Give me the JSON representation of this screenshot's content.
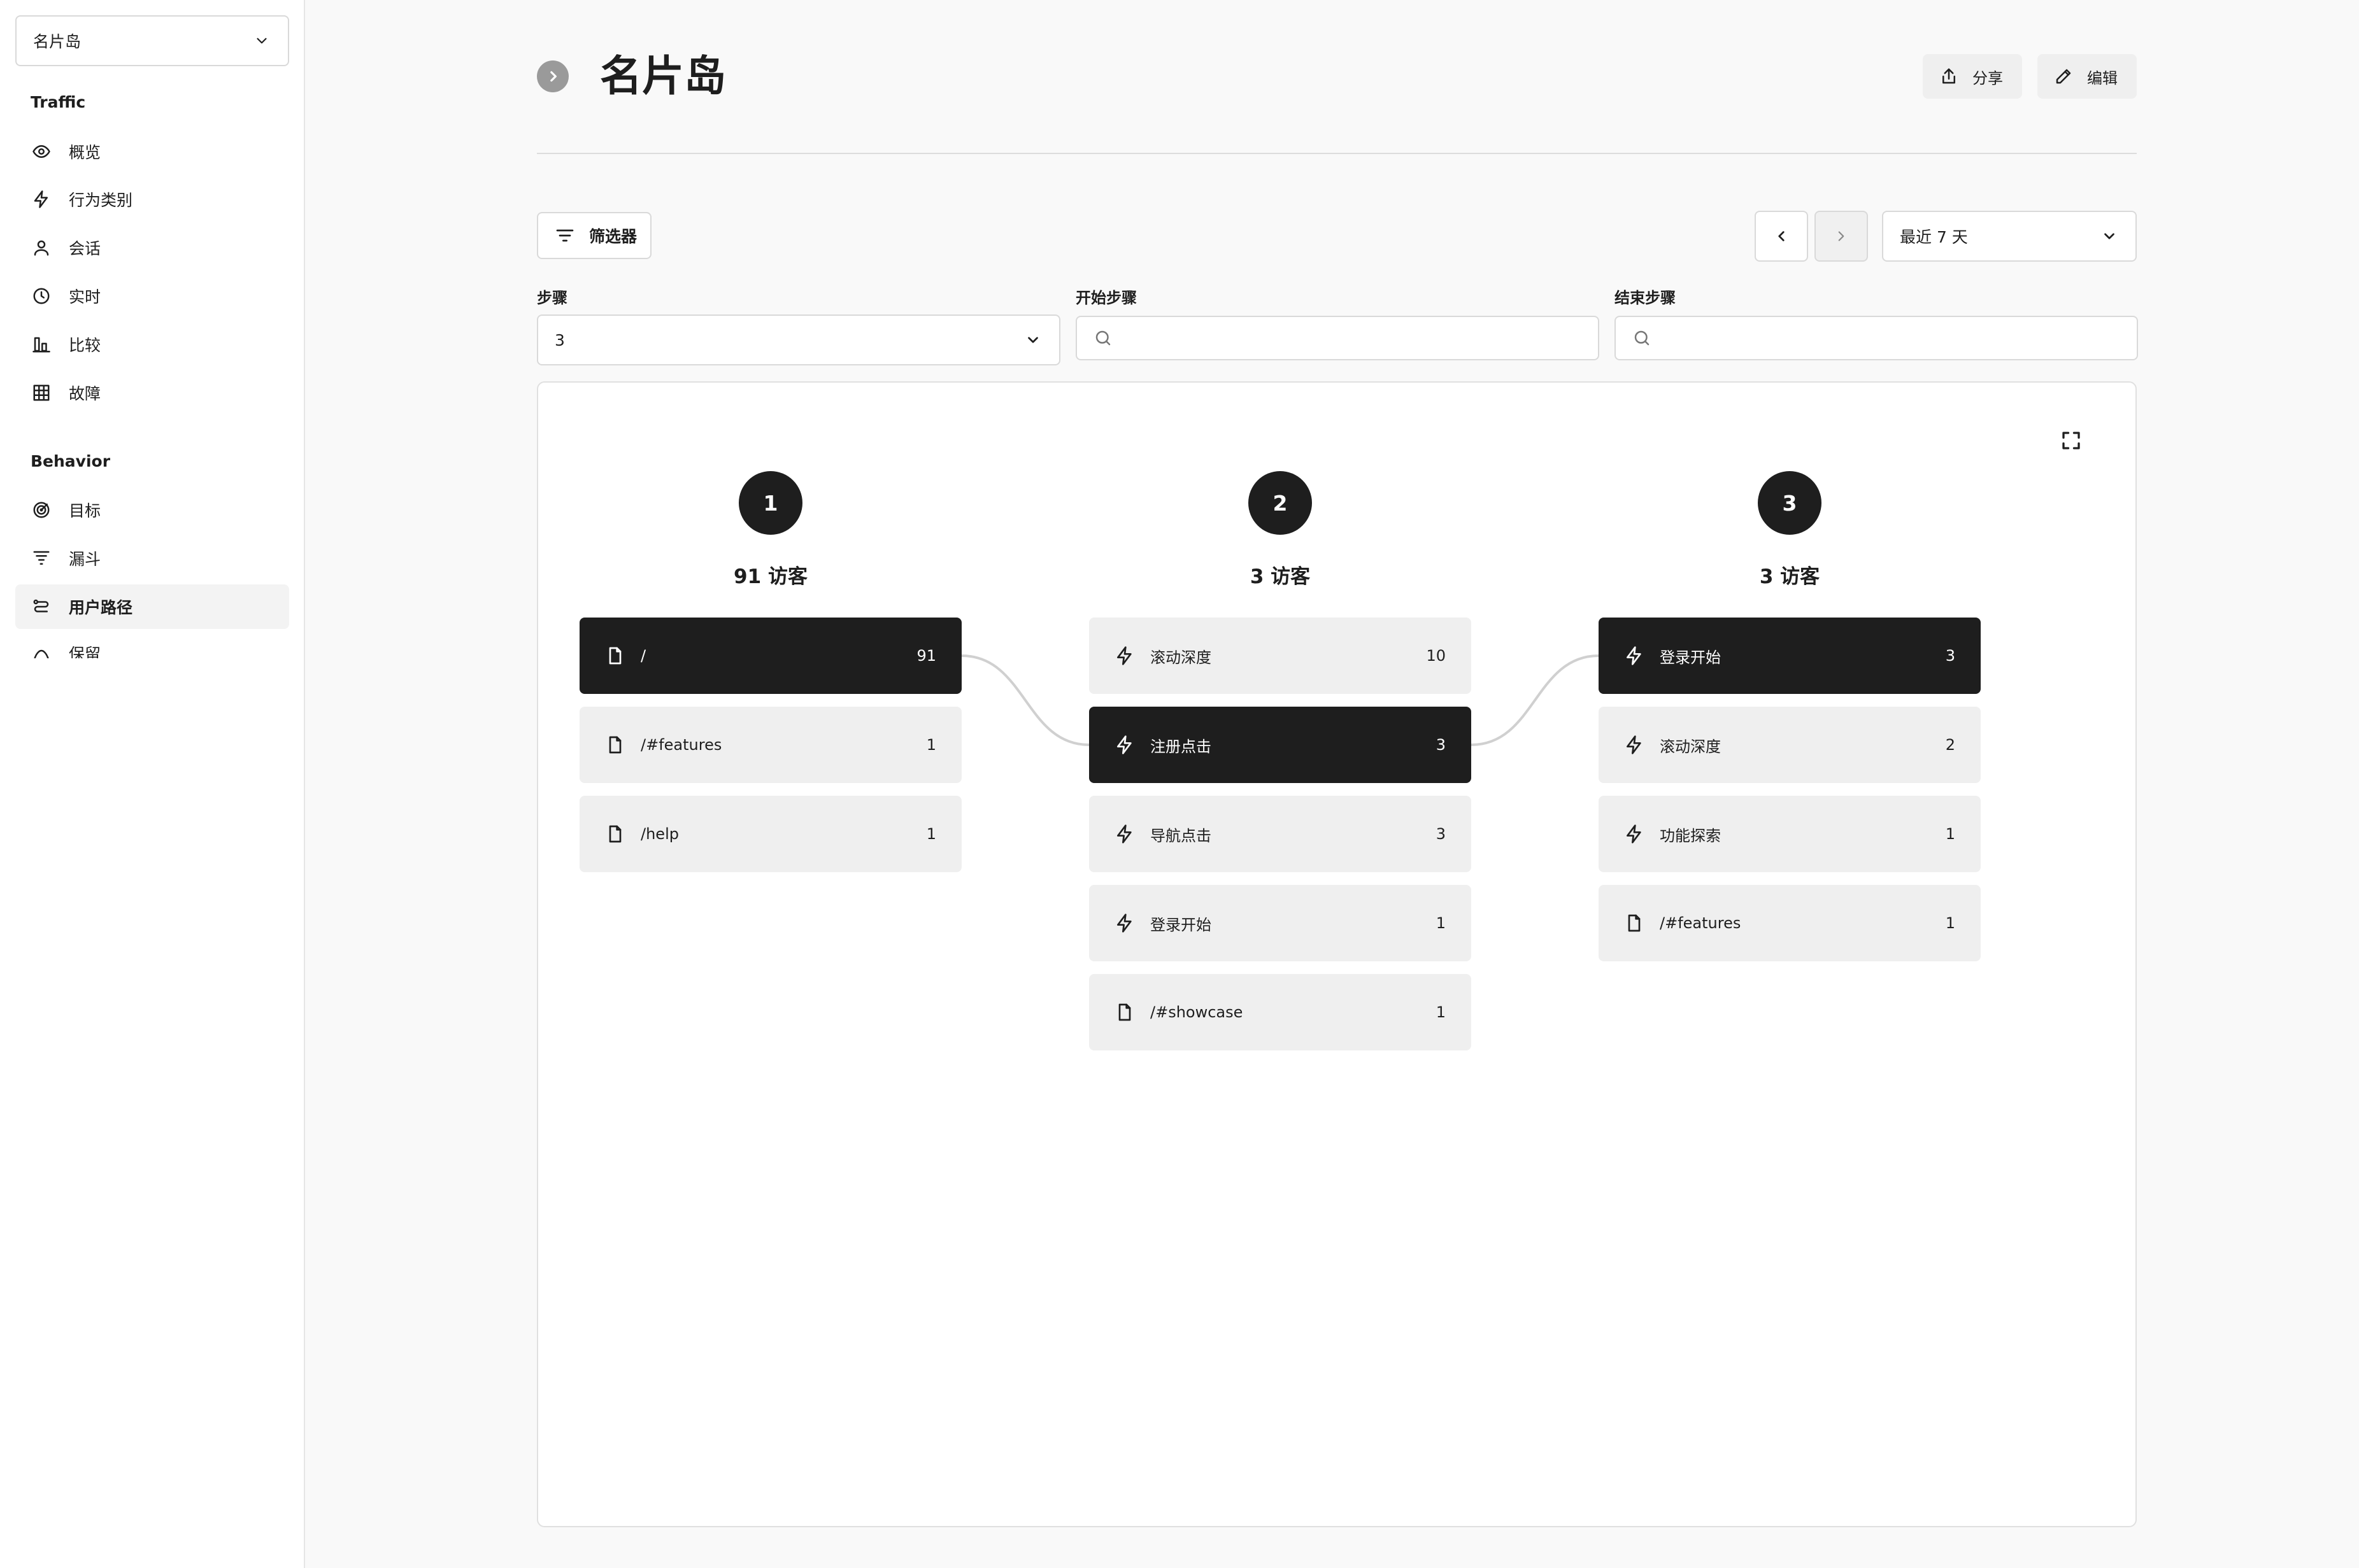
{
  "site_selector": {
    "value": "名片岛"
  },
  "sidebar": {
    "traffic_title": "Traffic",
    "traffic_items": [
      {
        "label": "概览",
        "icon": "eye-icon"
      },
      {
        "label": "行为类别",
        "icon": "lightning-icon"
      },
      {
        "label": "会话",
        "icon": "user-icon"
      },
      {
        "label": "实时",
        "icon": "clock-icon"
      },
      {
        "label": "比较",
        "icon": "compare-icon"
      },
      {
        "label": "故障",
        "icon": "table-icon"
      }
    ],
    "behavior_title": "Behavior",
    "behavior_items": [
      {
        "label": "目标",
        "icon": "target-icon"
      },
      {
        "label": "漏斗",
        "icon": "funnel-icon"
      },
      {
        "label": "用户路径",
        "icon": "path-icon",
        "active": true
      },
      {
        "label": "保留",
        "icon": "retention-icon"
      }
    ]
  },
  "header": {
    "title": "名片岛",
    "share_label": "分享",
    "edit_label": "编辑"
  },
  "filters": {
    "filter_label": "筛选器",
    "date_range": "最近 7 天"
  },
  "controls": {
    "steps_label": "步骤",
    "steps_value": "3",
    "start_step_label": "开始步骤",
    "end_step_label": "结束步骤"
  },
  "journey": {
    "steps": [
      {
        "number": "1",
        "visitors": "91 访客",
        "nodes": [
          {
            "type": "page",
            "icon": "file-icon",
            "label": "/",
            "count": "91",
            "selected": true
          },
          {
            "type": "page",
            "icon": "file-icon",
            "label": "/#features",
            "count": "1"
          },
          {
            "type": "page",
            "icon": "file-icon",
            "label": "/help",
            "count": "1"
          }
        ]
      },
      {
        "number": "2",
        "visitors": "3 访客",
        "nodes": [
          {
            "type": "event",
            "icon": "lightning-icon",
            "label": "滚动深度",
            "count": "10"
          },
          {
            "type": "event",
            "icon": "lightning-icon",
            "label": "注册点击",
            "count": "3",
            "selected": true
          },
          {
            "type": "event",
            "icon": "lightning-icon",
            "label": "导航点击",
            "count": "3"
          },
          {
            "type": "event",
            "icon": "lightning-icon",
            "label": "登录开始",
            "count": "1"
          },
          {
            "type": "page",
            "icon": "file-icon",
            "label": "/#showcase",
            "count": "1"
          }
        ]
      },
      {
        "number": "3",
        "visitors": "3 访客",
        "nodes": [
          {
            "type": "event",
            "icon": "lightning-icon",
            "label": "登录开始",
            "count": "3",
            "selected": true
          },
          {
            "type": "event",
            "icon": "lightning-icon",
            "label": "滚动深度",
            "count": "2"
          },
          {
            "type": "event",
            "icon": "lightning-icon",
            "label": "功能探索",
            "count": "1"
          },
          {
            "type": "page",
            "icon": "file-icon",
            "label": "/#features",
            "count": "1"
          }
        ]
      }
    ]
  },
  "colors": {
    "selected_node": "#1e1e1e",
    "node_bg": "#efefef",
    "connector": "#d0d0d0"
  }
}
